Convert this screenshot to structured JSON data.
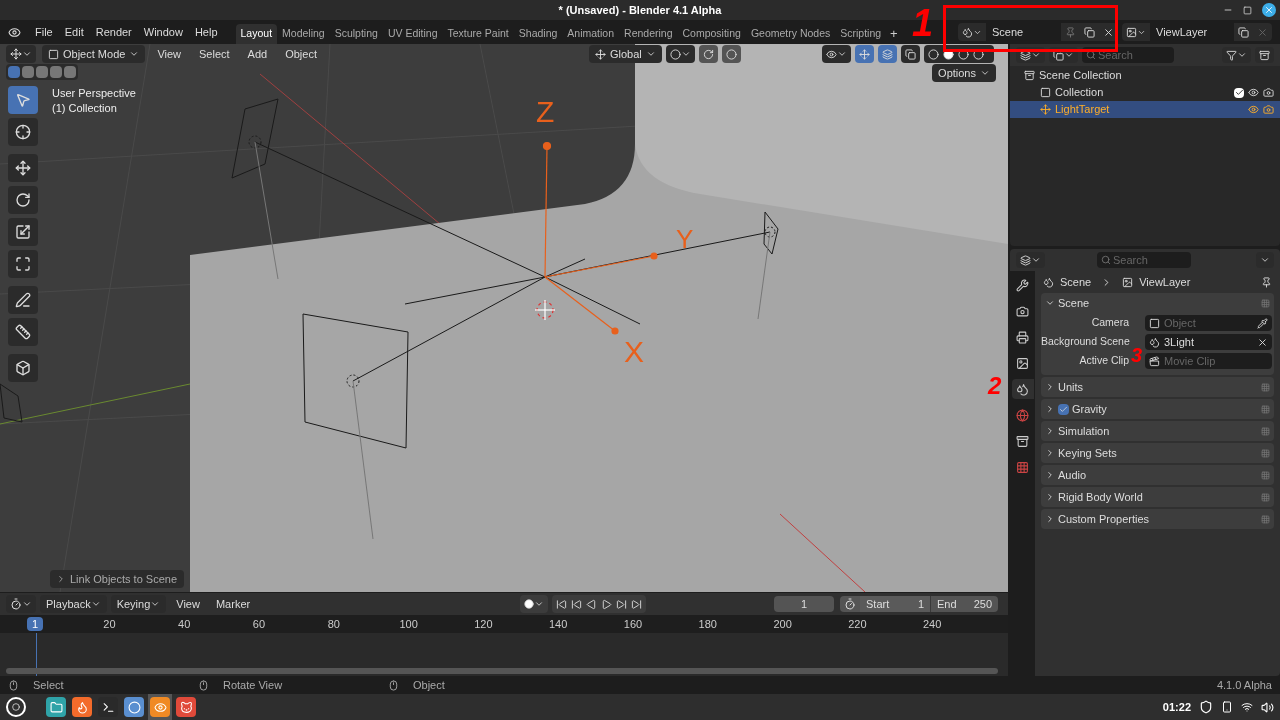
{
  "window": {
    "title": "* (Unsaved) - Blender 4.1 Alpha"
  },
  "menu": [
    "File",
    "Edit",
    "Render",
    "Window",
    "Help"
  ],
  "workspaces": [
    {
      "label": "Layout",
      "selected": true
    },
    {
      "label": "Modeling",
      "selected": false
    },
    {
      "label": "Sculpting",
      "selected": false
    },
    {
      "label": "UV Editing",
      "selected": false
    },
    {
      "label": "Texture Paint",
      "selected": false
    },
    {
      "label": "Shading",
      "selected": false
    },
    {
      "label": "Animation",
      "selected": false
    },
    {
      "label": "Rendering",
      "selected": false
    },
    {
      "label": "Compositing",
      "selected": false
    },
    {
      "label": "Geometry Nodes",
      "selected": false
    },
    {
      "label": "Scripting",
      "selected": false
    }
  ],
  "add_workspace": "+",
  "scene_selector": {
    "value": "Scene"
  },
  "view_layer_selector": {
    "value": "ViewLayer"
  },
  "viewport": {
    "mode": "Object Mode",
    "menus": [
      "View",
      "Select",
      "Add",
      "Object"
    ],
    "orientation": "Global",
    "options": "Options",
    "overlay_text": [
      "User Perspective",
      "(1) Collection"
    ],
    "tools": [
      {
        "kind": "select",
        "selected": true
      },
      {
        "kind": "cursor",
        "selected": false
      },
      {
        "kind": "move",
        "selected": false
      },
      {
        "kind": "rotate",
        "selected": false
      },
      {
        "kind": "scale",
        "selected": false
      },
      {
        "kind": "transform",
        "selected": false
      },
      {
        "kind": "annotate",
        "selected": false
      },
      {
        "kind": "measure",
        "selected": false
      },
      {
        "kind": "add-cube",
        "selected": false
      }
    ],
    "axis_labels": [
      "Z",
      "Y",
      "X"
    ],
    "last_operator": "Link Objects to Scene"
  },
  "outliner": {
    "search": {
      "placeholder": "Search"
    },
    "items": [
      {
        "label": "Scene Collection",
        "kind": "root",
        "selected": false,
        "children": [
          {
            "label": "Collection",
            "kind": "collection",
            "selected": false,
            "checked": true
          },
          {
            "label": "LightTarget",
            "kind": "object",
            "selected": true
          }
        ]
      }
    ]
  },
  "properties": {
    "search": {
      "placeholder": "Search"
    },
    "tabs": [
      {
        "kind": "tool",
        "selected": false
      },
      {
        "kind": "render",
        "selected": false
      },
      {
        "kind": "output",
        "selected": false
      },
      {
        "kind": "view-layer",
        "selected": false
      },
      {
        "kind": "scene",
        "selected": true
      },
      {
        "kind": "world",
        "selected": false
      },
      {
        "kind": "collection",
        "selected": false
      },
      {
        "kind": "texture",
        "selected": false
      }
    ],
    "breadcrumb": [
      "Scene",
      "ViewLayer"
    ],
    "panels": [
      {
        "title": "Scene",
        "expanded": true,
        "fields": [
          {
            "label": "Camera",
            "kind": "object",
            "placeholder": "Object"
          },
          {
            "label": "Background Scene",
            "kind": "scene",
            "value": "3Light"
          },
          {
            "label": "Active Clip",
            "kind": "clip",
            "placeholder": "Movie Clip"
          }
        ]
      },
      {
        "title": "Units",
        "expanded": false
      },
      {
        "title": "Gravity",
        "expanded": false,
        "checked": true
      },
      {
        "title": "Simulation",
        "expanded": false
      },
      {
        "title": "Keying Sets",
        "expanded": false
      },
      {
        "title": "Audio",
        "expanded": false
      },
      {
        "title": "Rigid Body World",
        "expanded": false
      },
      {
        "title": "Custom Properties",
        "expanded": false
      }
    ]
  },
  "timeline": {
    "menus": [
      "Playback",
      "Keying",
      "View",
      "Marker"
    ],
    "current_frame": "1",
    "start_label": "Start",
    "start": "1",
    "end_label": "End",
    "end": "250",
    "playhead": "1",
    "ticks": [
      "20",
      "40",
      "60",
      "80",
      "100",
      "120",
      "140",
      "160",
      "180",
      "200",
      "220",
      "240"
    ]
  },
  "status_bar": {
    "hints": [
      "Select",
      "Rotate View",
      "Object"
    ],
    "version": "4.1.0 Alpha"
  },
  "taskbar": {
    "apps": [
      {
        "kind": "files",
        "selected": false
      },
      {
        "kind": "browser",
        "selected": false
      },
      {
        "kind": "terminal",
        "selected": false
      },
      {
        "kind": "web",
        "selected": false
      },
      {
        "kind": "blender",
        "selected": true
      },
      {
        "kind": "image-editor",
        "selected": false
      }
    ],
    "time": "01:22"
  },
  "annotations": [
    "1",
    "2",
    "3"
  ]
}
